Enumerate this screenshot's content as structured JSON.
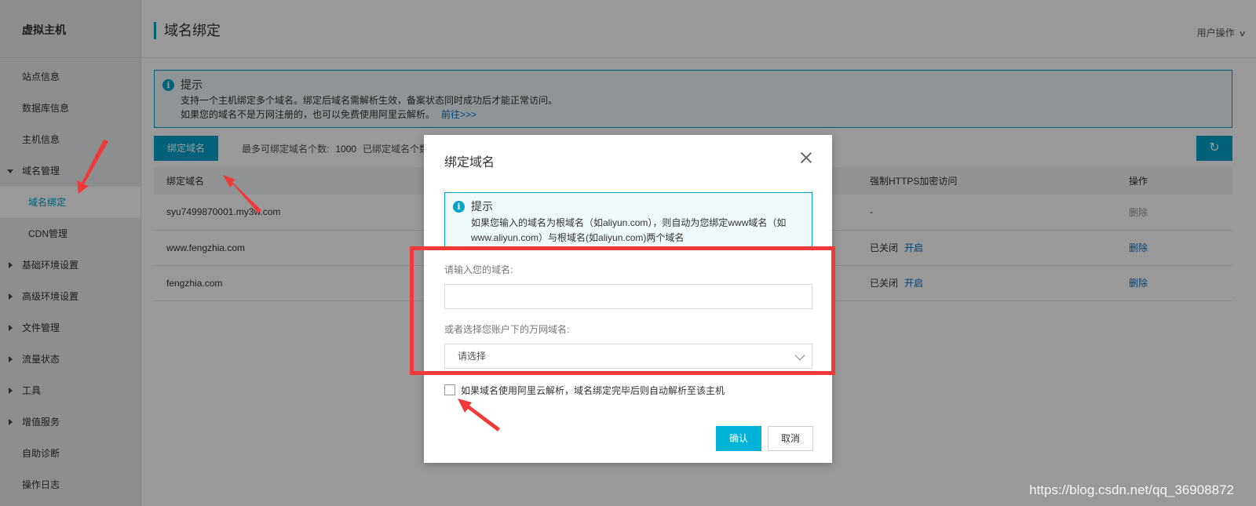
{
  "sidebar": {
    "title": "虚拟主机",
    "items": [
      {
        "label": "站点信息"
      },
      {
        "label": "数据库信息"
      },
      {
        "label": "主机信息"
      },
      {
        "label": "域名管理"
      },
      {
        "label": "域名绑定"
      },
      {
        "label": "CDN管理"
      },
      {
        "label": "基础环境设置"
      },
      {
        "label": "高级环境设置"
      },
      {
        "label": "文件管理"
      },
      {
        "label": "流量状态"
      },
      {
        "label": "工具"
      },
      {
        "label": "增值服务"
      },
      {
        "label": "自助诊断"
      },
      {
        "label": "操作日志"
      }
    ]
  },
  "header": {
    "title": "域名绑定",
    "user_ops": "用户操作"
  },
  "tip": {
    "title": "提示",
    "line1": "支持一个主机绑定多个域名。绑定后域名需解析生效，备案状态同时成功后才能正常访问。",
    "line2": "如果您的域名不是万网注册的，也可以免费使用阿里云解析。",
    "link": "前往>>>"
  },
  "toolbar": {
    "bind_button": "绑定域名",
    "max_label": "最多可绑定域名个数:",
    "max_value": "1000",
    "bound_label": "已绑定域名个数:"
  },
  "table": {
    "columns": [
      "绑定域名",
      "强制HTTPS加密访问",
      "操作"
    ],
    "rows": [
      {
        "domain": "syu7499870001.my3w.com",
        "https": "-",
        "https_action": "",
        "op": "删除"
      },
      {
        "domain": "www.fengzhia.com",
        "https": "已关闭",
        "https_action": "开启",
        "op": "删除"
      },
      {
        "domain": "fengzhia.com",
        "https": "已关闭",
        "https_action": "开启",
        "op": "删除"
      }
    ]
  },
  "modal": {
    "title": "绑定域名",
    "tip_title": "提示",
    "tip_line1": "如果您输入的域名为根域名（如aliyun.com），则自动为您绑定www域名（如",
    "tip_line2": "www.aliyun.com）与根域名(如aliyun.com)两个域名",
    "input_label": "请输入您的域名:",
    "input_value": "",
    "select_label": "或者选择您账户下的万网域名:",
    "select_placeholder": "请选择",
    "checkbox_label": "如果域名使用阿里云解析，域名绑定完毕后则自动解析至该主机",
    "ok": "确认",
    "cancel": "取消"
  },
  "watermark": "https://blog.csdn.net/qq_36908872",
  "colors": {
    "accent": "#00a2ca",
    "link": "#0070cc",
    "annotation": "#f03a3a"
  }
}
